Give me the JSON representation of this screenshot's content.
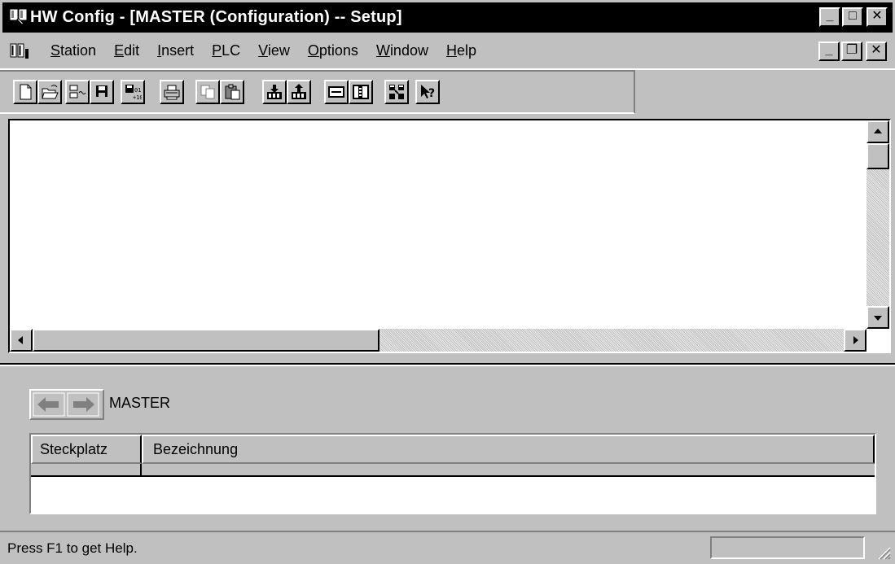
{
  "window": {
    "title": "HW Config - [MASTER (Configuration) -- Setup]",
    "min_glyph": "_",
    "max_glyph": "□",
    "close_glyph": "✕",
    "restore_glyph": "❐"
  },
  "menu": {
    "items": [
      {
        "label": "Station",
        "accel": "S",
        "rest": "tation"
      },
      {
        "label": "Edit",
        "accel": "E",
        "rest": "dit"
      },
      {
        "label": "Insert",
        "accel": "I",
        "rest": "nsert"
      },
      {
        "label": "PLC",
        "accel": "P",
        "rest": "LC"
      },
      {
        "label": "View",
        "accel": "V",
        "rest": "iew"
      },
      {
        "label": "Options",
        "accel": "O",
        "rest": "ptions"
      },
      {
        "label": "Window",
        "accel": "W",
        "rest": "indow"
      },
      {
        "label": "Help",
        "accel": "H",
        "rest": "elp"
      }
    ]
  },
  "toolbar": {
    "buttons": [
      "new-icon",
      "open-icon",
      "save-compile-icon",
      "save-icon",
      "compile-icon",
      "print-icon",
      "copy-icon",
      "paste-icon",
      "download-icon",
      "upload-icon",
      "module-view-icon",
      "catalog-icon",
      "network-icon",
      "whats-this-icon"
    ]
  },
  "detail": {
    "station_name": "MASTER",
    "columns": [
      "Steckplatz",
      "Bezeichnung"
    ],
    "rows": []
  },
  "status": {
    "text": "Press F1 to get Help."
  }
}
